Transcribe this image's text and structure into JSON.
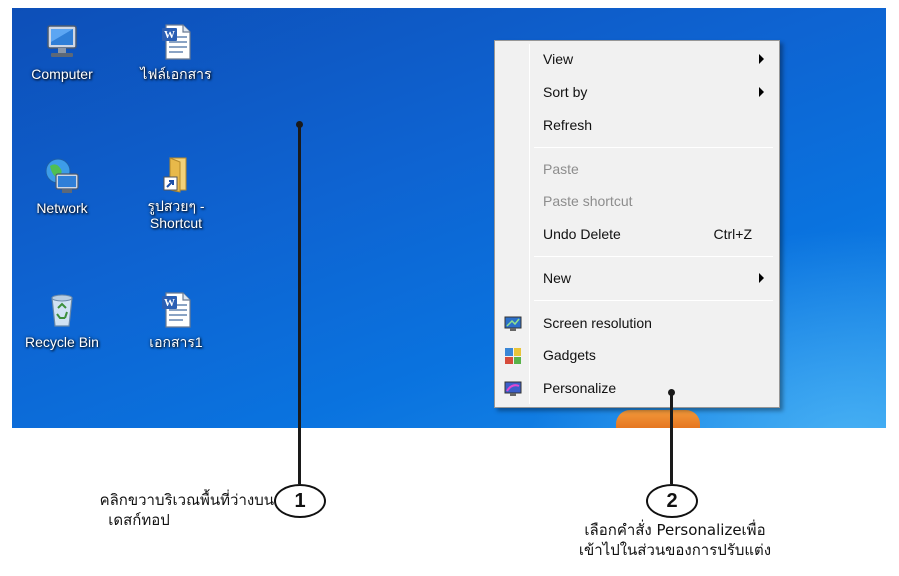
{
  "desktop": {
    "icons": [
      {
        "label": "Computer",
        "icon": "computer-icon"
      },
      {
        "label": "ไฟล์เอกสาร",
        "icon": "word-document-icon"
      },
      {
        "label": "Network",
        "icon": "network-icon"
      },
      {
        "label": "รูปสวยๆ -\nShortcut",
        "icon": "folder-shortcut-icon"
      },
      {
        "label": "Recycle Bin",
        "icon": "recycle-bin-icon"
      },
      {
        "label": "เอกสาร1",
        "icon": "word-document-icon"
      }
    ]
  },
  "context_menu": {
    "items": [
      {
        "label": "View",
        "submenu": true,
        "disabled": false
      },
      {
        "label": "Sort by",
        "submenu": true,
        "disabled": false
      },
      {
        "label": "Refresh",
        "submenu": false,
        "disabled": false
      },
      {
        "label": "Paste",
        "submenu": false,
        "disabled": true
      },
      {
        "label": "Paste shortcut",
        "submenu": false,
        "disabled": true
      },
      {
        "label": "Undo Delete",
        "shortcut": "Ctrl+Z",
        "submenu": false,
        "disabled": false
      },
      {
        "label": "New",
        "submenu": true,
        "disabled": false
      },
      {
        "label": "Screen resolution",
        "icon": "screen-resolution-icon",
        "submenu": false,
        "disabled": false
      },
      {
        "label": "Gadgets",
        "icon": "gadgets-icon",
        "submenu": false,
        "disabled": false
      },
      {
        "label": "Personalize",
        "icon": "personalize-icon",
        "submenu": false,
        "disabled": false
      }
    ]
  },
  "annotations": {
    "step1": {
      "number": "1",
      "line1": "คลิกขวาบริเวณพื้นที่ว่างบน",
      "line2": "เดสก์ทอป"
    },
    "step2": {
      "number": "2",
      "line1": "เลือกคำสั่ง Personalizeเพื่อ",
      "line2": "เข้าไปในส่วนของการปรับแต่ง"
    }
  },
  "colors": {
    "desktop_background": "#0e63d1",
    "menu_background": "#f1f1f1",
    "disabled_text": "#8d8d8d"
  }
}
